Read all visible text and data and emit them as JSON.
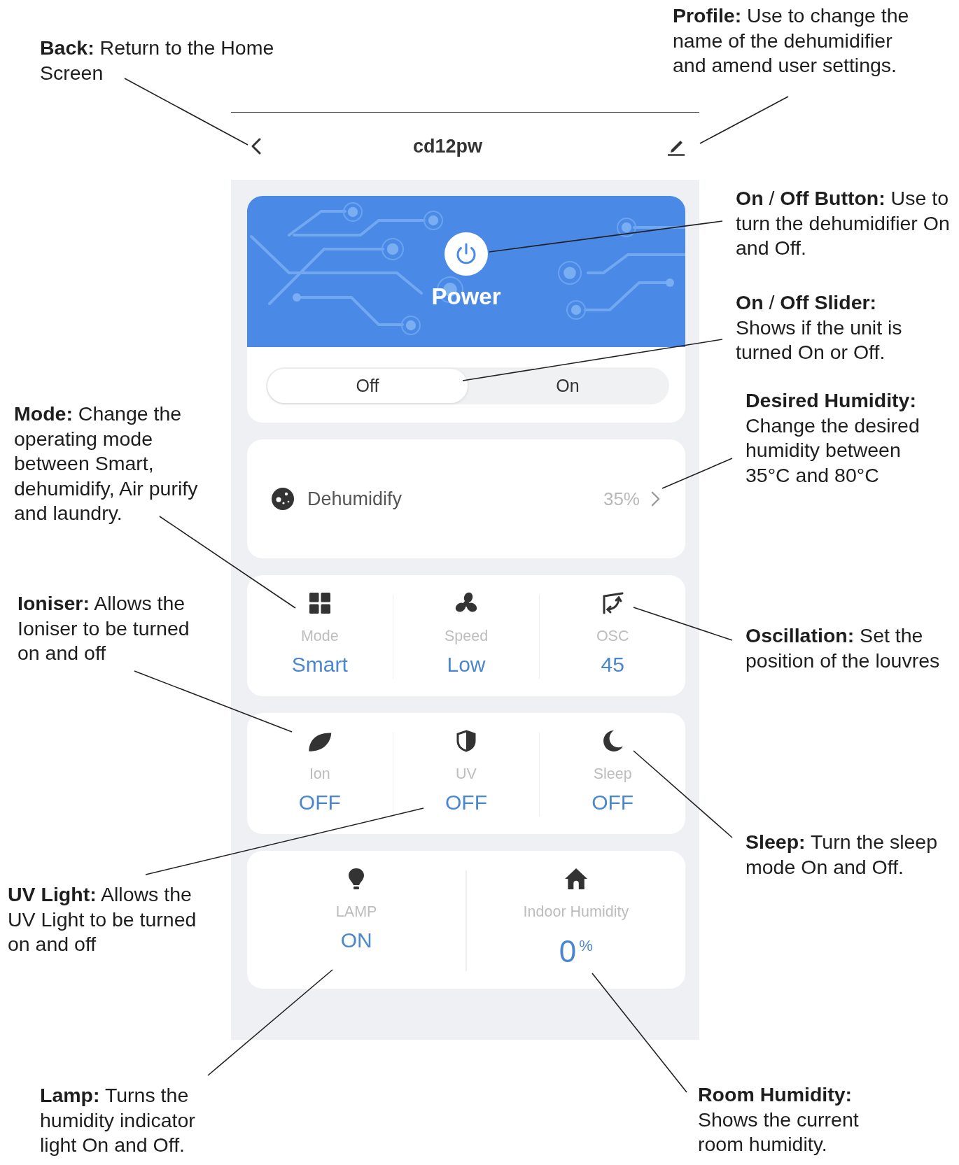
{
  "app": {
    "title": "cd12pw"
  },
  "power": {
    "label": "Power",
    "switch": [
      {
        "label": "Off",
        "selected": true
      },
      {
        "label": "On",
        "selected": false
      }
    ]
  },
  "mode_row": {
    "label": "Dehumidify",
    "value": "35%"
  },
  "tile_cards": [
    [
      {
        "kind": "setting",
        "label": "Mode",
        "value": "Smart"
      },
      {
        "kind": "setting",
        "label": "Speed",
        "value": "Low"
      },
      {
        "kind": "setting",
        "label": "OSC",
        "value": "45"
      }
    ],
    [
      {
        "kind": "setting",
        "label": "Ion",
        "value": "OFF"
      },
      {
        "kind": "setting",
        "label": "UV",
        "value": "OFF"
      },
      {
        "kind": "setting",
        "label": "Sleep",
        "value": "OFF"
      }
    ],
    [
      {
        "kind": "setting",
        "label": "LAMP",
        "value": "ON"
      },
      {
        "kind": "reading",
        "label": "Indoor Humidity",
        "value": "0$^{%}$"
      }
    ]
  ],
  "callouts": [
    {
      "lines": [
        "**Back:** Return to the Home",
        "Screen"
      ]
    },
    {
      "lines": [
        "**Profile:** Use to change the",
        "name of the dehumidifier",
        "and amend user settings."
      ]
    },
    {
      "lines": [
        "**On** / **Off Button:** Use to",
        "turn the dehumidifier On",
        "and Off."
      ]
    },
    {
      "lines": [
        "**On** / **Off Slider:**",
        "Shows if the unit is",
        "turned On or Off."
      ]
    },
    {
      "lines": [
        "**Desired Humidity:**",
        "Change the desired",
        "humidity between",
        "35°C and 80°C"
      ]
    },
    {
      "lines": [
        "**Mode:** Change the",
        "operating mode",
        "between Smart,",
        "dehumidify, Air purify",
        "and laundry."
      ]
    },
    {
      "lines": [
        "**Ioniser:** Allows the",
        "Ioniser to be turned",
        "on and off"
      ]
    },
    {
      "lines": [
        "**Oscillation:** Set the",
        "position of the louvres"
      ]
    },
    {
      "lines": [
        "**Sleep:** Turn the sleep",
        "mode On and Off."
      ]
    },
    {
      "lines": [
        "**UV Light:** Allows the",
        "UV Light to be turned",
        "on and off"
      ]
    },
    {
      "lines": [
        "**Lamp:** Turns the",
        "humidity indicator",
        "light On and Off."
      ]
    },
    {
      "lines": [
        "**Room Humidity:**",
        "Shows the current",
        "room humidity."
      ]
    }
  ]
}
